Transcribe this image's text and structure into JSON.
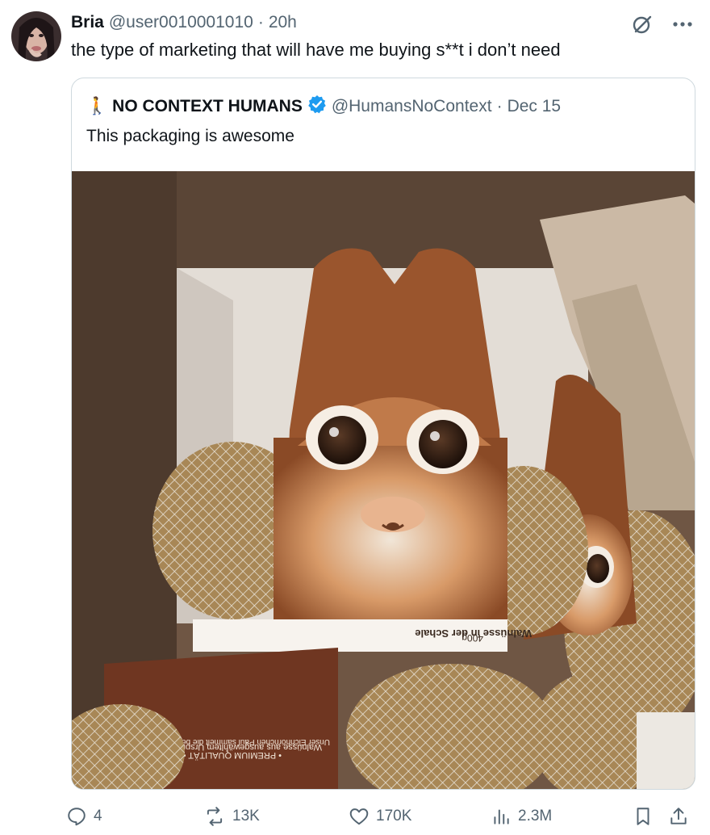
{
  "tweet": {
    "author_name": "Bria",
    "handle": "@user0010001010",
    "separator": "·",
    "time": "20h",
    "text": "the type of marketing that will have me buying s**t i don’t need"
  },
  "top_icons": [
    "grok-icon",
    "more-icon"
  ],
  "quote": {
    "emoji": "🚶",
    "name": "NO CONTEXT HUMANS",
    "verified": true,
    "handle": "@HumansNoContext",
    "separator": "·",
    "date": "Dec 15",
    "text": "This packaging is awesome",
    "photo_text": {
      "label_center": "Walnüsse in der Schale",
      "label_weight": "400g",
      "box_line1": "• PREMIUM QUALITÄT •",
      "box_line2": "Walnüsse aus ausgewähltem Ursprung",
      "box_line3": "Unser Eichhörnchen Paul sammelt die besten Walnüsse"
    }
  },
  "actions": {
    "replies": "4",
    "reposts": "13K",
    "likes": "170K",
    "views": "2.3M"
  },
  "colors": {
    "text": "#0f1419",
    "muted": "#536471",
    "verified": "#1d9bf0",
    "border": "#cfd9de"
  }
}
